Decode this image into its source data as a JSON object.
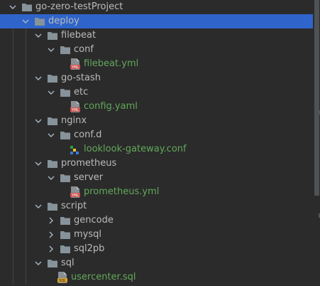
{
  "tree": {
    "items": [
      {
        "label": "go-zero-testProject",
        "kind": "folder",
        "expanded": true,
        "depth": 0
      },
      {
        "label": "deploy",
        "kind": "folder",
        "expanded": true,
        "depth": 1,
        "selected": true
      },
      {
        "label": "filebeat",
        "kind": "folder",
        "expanded": true,
        "depth": 2
      },
      {
        "label": "conf",
        "kind": "folder",
        "expanded": true,
        "depth": 3
      },
      {
        "label": "filebeat.yml",
        "kind": "file",
        "icon": "yml-file-icon",
        "badge": "YML",
        "depth": 4
      },
      {
        "label": "go-stash",
        "kind": "folder",
        "expanded": true,
        "depth": 2
      },
      {
        "label": "etc",
        "kind": "folder",
        "expanded": true,
        "depth": 3
      },
      {
        "label": "config.yaml",
        "kind": "file",
        "icon": "yml-file-icon",
        "badge": "YML",
        "depth": 4
      },
      {
        "label": "nginx",
        "kind": "folder",
        "expanded": true,
        "depth": 2
      },
      {
        "label": "conf.d",
        "kind": "folder",
        "expanded": true,
        "depth": 3
      },
      {
        "label": "looklook-gateway.conf",
        "kind": "file",
        "icon": "nginx-conf-file-icon",
        "depth": 4
      },
      {
        "label": "prometheus",
        "kind": "folder",
        "expanded": true,
        "depth": 2
      },
      {
        "label": "server",
        "kind": "folder",
        "expanded": true,
        "depth": 3
      },
      {
        "label": "prometheus.yml",
        "kind": "file",
        "icon": "yml-file-icon",
        "badge": "YML",
        "depth": 4
      },
      {
        "label": "script",
        "kind": "folder",
        "expanded": true,
        "depth": 2
      },
      {
        "label": "gencode",
        "kind": "folder",
        "expanded": false,
        "depth": 3
      },
      {
        "label": "mysql",
        "kind": "folder",
        "expanded": false,
        "depth": 3
      },
      {
        "label": "sql2pb",
        "kind": "folder",
        "expanded": false,
        "depth": 3
      },
      {
        "label": "sql",
        "kind": "folder",
        "expanded": true,
        "depth": 2
      },
      {
        "label": "usercenter.sql",
        "kind": "file",
        "icon": "sql-file-icon",
        "badge": "SQL",
        "depth": 3
      }
    ]
  },
  "colors": {
    "background": "#2b2b2b",
    "selection": "#2f65ca",
    "text": "#bbbbbb",
    "modified_file": "#62a85a",
    "folder": "#87939a"
  }
}
